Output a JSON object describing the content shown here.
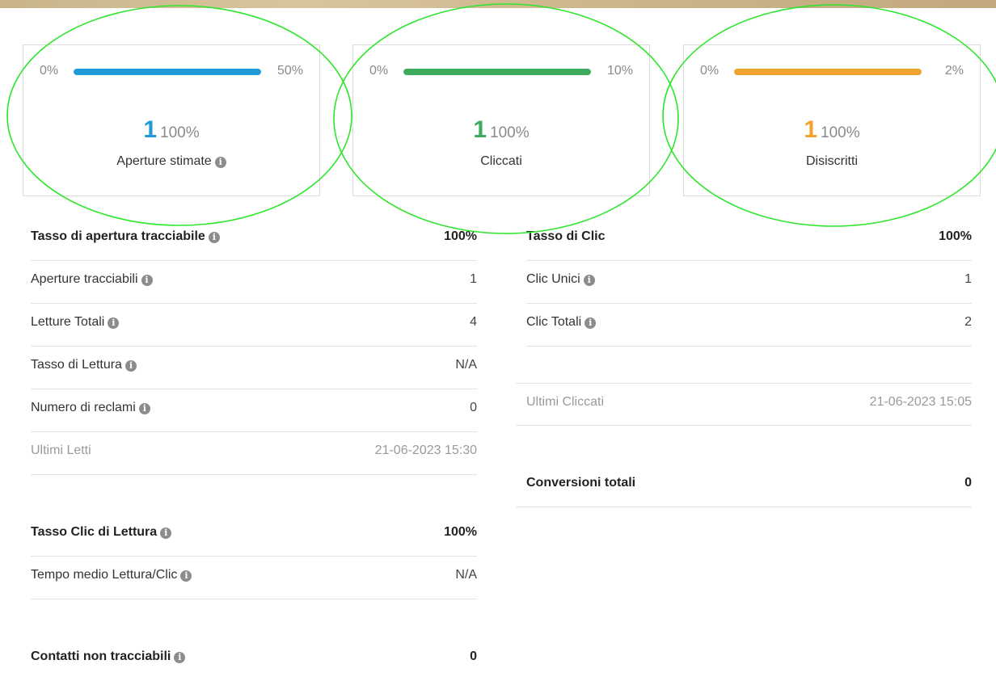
{
  "cards": [
    {
      "min": "0%",
      "max": "50%",
      "count": "1",
      "percent": "100%",
      "caption": "Aperture stimate",
      "color": "#1e9ad6",
      "fill": 1.0
    },
    {
      "min": "0%",
      "max": "10%",
      "count": "1",
      "percent": "100%",
      "caption": "Cliccati",
      "color": "#3cab5d",
      "fill": 1.0
    },
    {
      "min": "0%",
      "max": "2%",
      "count": "1",
      "percent": "100%",
      "caption": "Disiscritti",
      "color": "#f0a22f",
      "fill": 1.0
    }
  ],
  "highlight_color": "#2ee62e",
  "info_glyph": "i",
  "left": {
    "open_rate_label": "Tasso di apertura tracciabile",
    "open_rate_value": "100%",
    "trackable_opens_label": "Aperture tracciabili",
    "trackable_opens_value": "1",
    "total_reads_label": "Letture Totali",
    "total_reads_value": "4",
    "read_rate_label": "Tasso di Lettura",
    "read_rate_value": "N/A",
    "complaints_label": "Numero di reclami",
    "complaints_value": "0",
    "last_read_label": "Ultimi Letti",
    "last_read_value": "21-06-2023 15:30",
    "click_read_rate_label": "Tasso Clic di Lettura",
    "click_read_rate_value": "100%",
    "avg_time_label": "Tempo medio Lettura/Clic",
    "avg_time_value": "N/A",
    "untrackable_label": "Contatti non tracciabili",
    "untrackable_value": "0"
  },
  "right": {
    "click_rate_label": "Tasso di Clic",
    "click_rate_value": "100%",
    "unique_clicks_label": "Clic Unici",
    "unique_clicks_value": "1",
    "total_clicks_label": "Clic Totali",
    "total_clicks_value": "2",
    "last_clicked_label": "Ultimi Cliccati",
    "last_clicked_value": "21-06-2023 15:05",
    "conversions_label": "Conversioni totali",
    "conversions_value": "0"
  }
}
